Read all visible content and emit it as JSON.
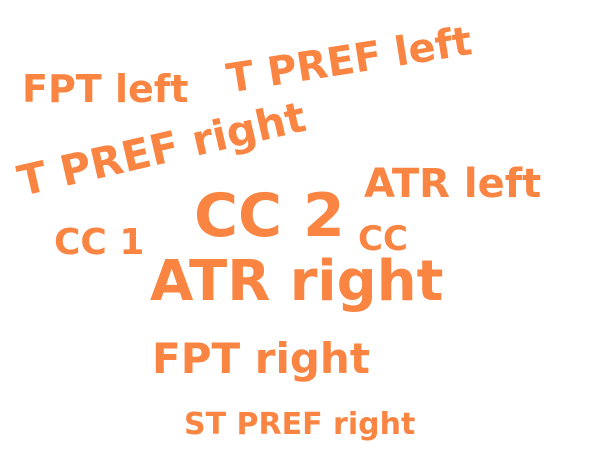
{
  "colors": {
    "word": "#FA8441",
    "background": "#FFFFFF"
  },
  "words": [
    {
      "id": "fpt-left",
      "text": "FPT left"
    },
    {
      "id": "t-pref-left",
      "text": "T PREF left"
    },
    {
      "id": "t-pref-right",
      "text": "T PREF right"
    },
    {
      "id": "atr-left",
      "text": "ATR left"
    },
    {
      "id": "cc-2",
      "text": "CC 2"
    },
    {
      "id": "cc-1",
      "text": "CC 1"
    },
    {
      "id": "cc",
      "text": "CC"
    },
    {
      "id": "atr-right",
      "text": "ATR right"
    },
    {
      "id": "fpt-right",
      "text": "FPT right"
    },
    {
      "id": "st-pref-right",
      "text": "ST PREF right"
    }
  ]
}
